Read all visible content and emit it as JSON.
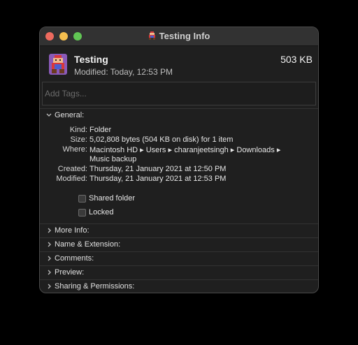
{
  "window": {
    "title": "Testing Info"
  },
  "summary": {
    "name": "Testing",
    "modified": "Modified: Today, 12:53 PM",
    "size": "503 KB"
  },
  "tags": {
    "placeholder": "Add Tags..."
  },
  "general": {
    "header": "General:",
    "fields": [
      {
        "label": "Kind:",
        "value": "Folder"
      },
      {
        "label": "Size:",
        "value": "5,02,808 bytes (504 KB on disk) for 1 item"
      },
      {
        "label": "Where:",
        "value": "Macintosh HD ▸ Users ▸ charanjeetsingh ▸ Downloads ▸",
        "value2": "Music backup"
      },
      {
        "label": "Created:",
        "value": "Thursday, 21 January 2021 at 12:50 PM"
      },
      {
        "label": "Modified:",
        "value": "Thursday, 21 January 2021 at 12:53 PM"
      }
    ],
    "shared_folder": "Shared folder",
    "locked": "Locked"
  },
  "sections": [
    "More Info:",
    "Name & Extension:",
    "Comments:",
    "Preview:",
    "Sharing & Permissions:"
  ]
}
